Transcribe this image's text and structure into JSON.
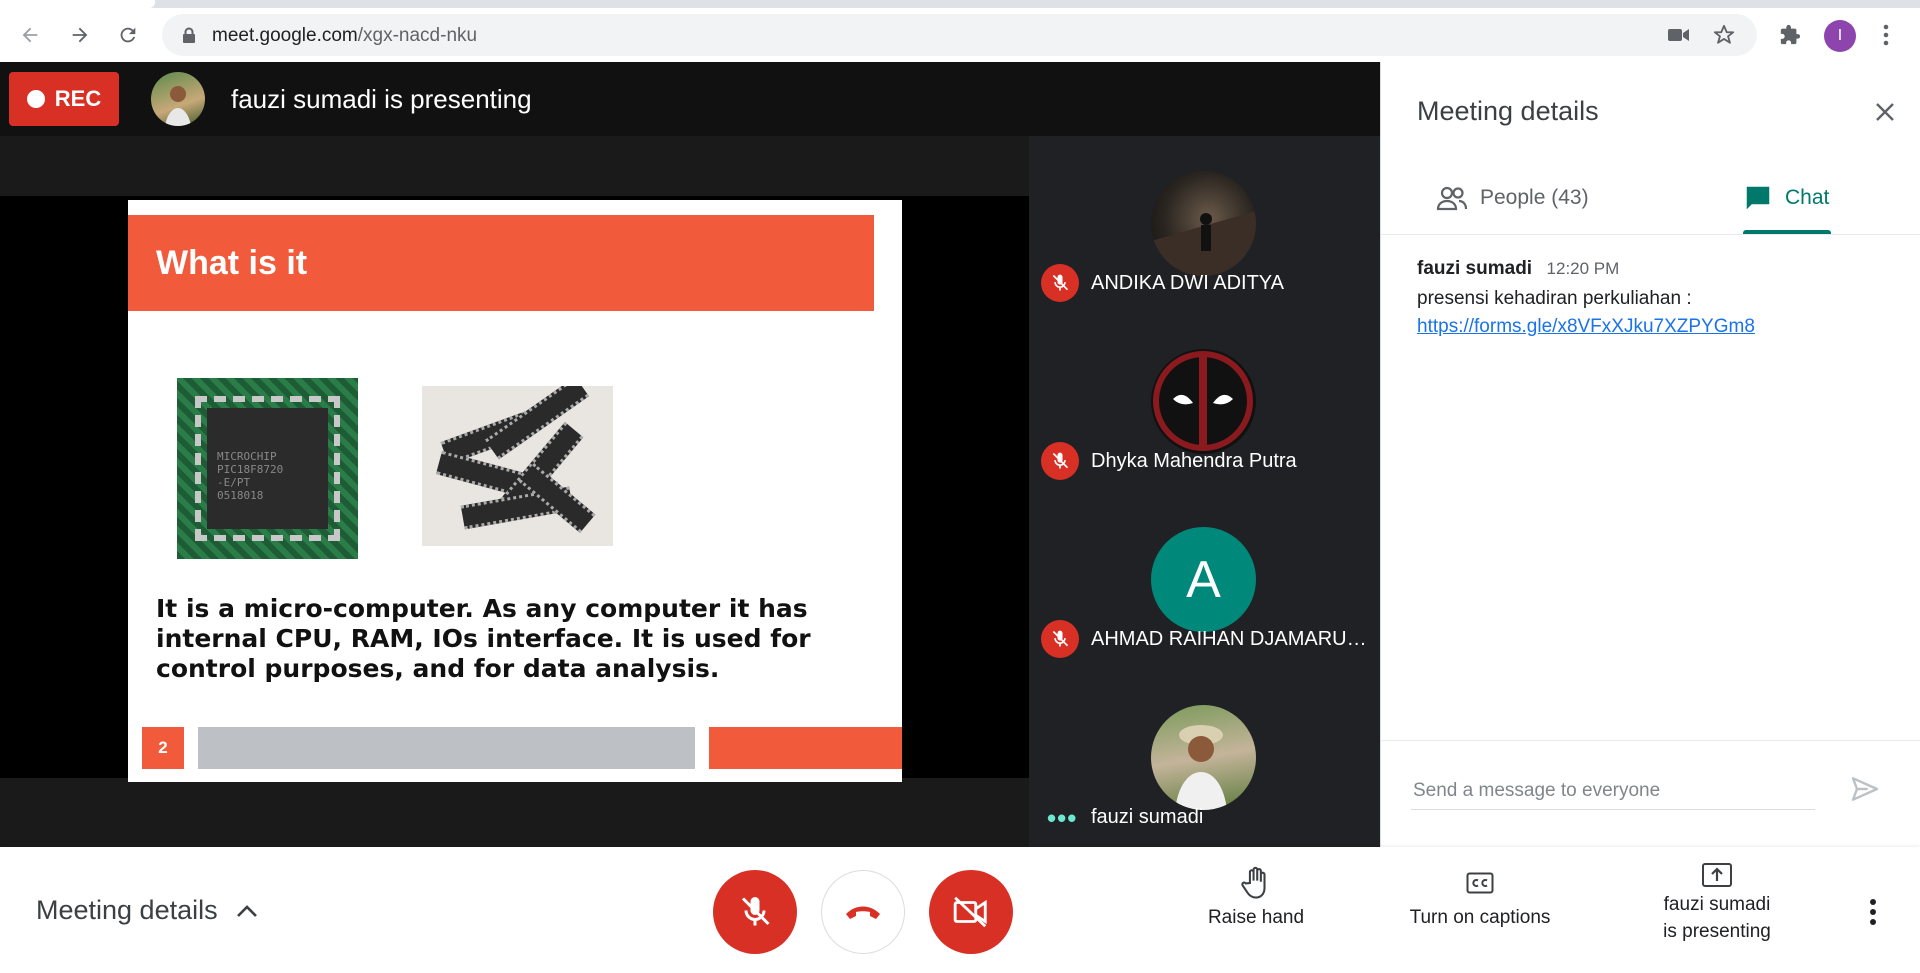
{
  "browser": {
    "url_domain": "meet.google.com",
    "url_path": "/xgx-nacd-nku",
    "profile_initial": "I"
  },
  "meeting": {
    "rec_label": "REC",
    "presenting_title": "fauzi sumadi is presenting"
  },
  "slide": {
    "title": "What is it",
    "chip_text": [
      "MICROCHIP",
      "PIC18F8720",
      "-E/PT",
      "0518018"
    ],
    "body": "It is a micro-computer. As any computer it has internal CPU, RAM, IOs interface. It is used for control purposes, and for data analysis.",
    "number": "2"
  },
  "participants": [
    {
      "name": "ANDIKA DWI ADITYA",
      "muted": true,
      "avatar": "photo"
    },
    {
      "name": "Dhyka Mahendra Putra",
      "muted": true,
      "avatar": "photo"
    },
    {
      "name": "AHMAD RAIHAN DJAMARUDDIN",
      "muted": true,
      "avatar": "initial",
      "initial": "A"
    },
    {
      "name": "fauzi sumadi",
      "muted": false,
      "avatar": "photo"
    }
  ],
  "side_panel": {
    "title": "Meeting details",
    "tabs": [
      {
        "label": "People (43)",
        "active": false
      },
      {
        "label": "Chat",
        "active": true
      }
    ],
    "messages": [
      {
        "sender": "fauzi sumadi",
        "time": "12:20 PM",
        "text": "presensi kehadiran perkuliahan :",
        "link": "https://forms.gle/x8VFxXJku7XZPYGm8"
      }
    ],
    "input_placeholder": "Send a message to everyone"
  },
  "bottom": {
    "details_label": "Meeting details",
    "raise_hand": "Raise hand",
    "captions": "Turn on captions",
    "presenting_line1": "fauzi sumadi",
    "presenting_line2": "is presenting"
  },
  "colors": {
    "accent_teal": "#00796b",
    "danger_red": "#d93025",
    "slide_orange": "#f15a3a"
  }
}
